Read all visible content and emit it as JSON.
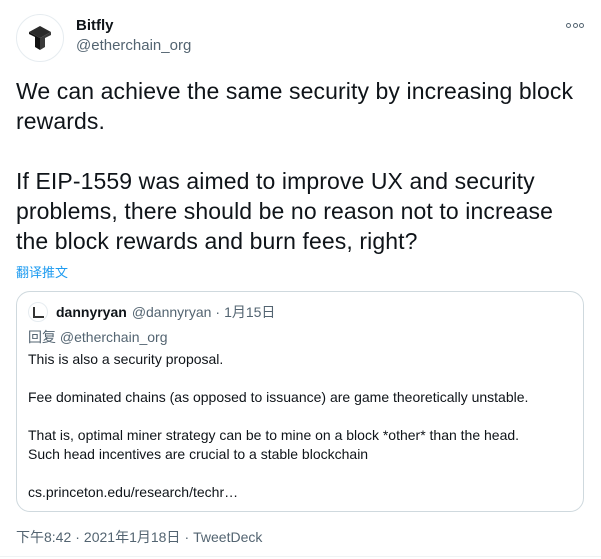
{
  "author": {
    "name": "Bitfly",
    "handle": "@etherchain_org",
    "avatar_icon": "bitfly-logo-icon"
  },
  "more_icon": "more-options-icon",
  "tweet": {
    "paragraphs": [
      "We can achieve the same security by increasing block rewards.",
      "If EIP-1559 was aimed to improve UX and security problems, there should be no reason not to increase the block rewards and burn fees, right?"
    ]
  },
  "translate_label": "翻译推文",
  "quote": {
    "name": "dannyryan",
    "handle": "@dannyryan",
    "separator": "·",
    "date": "1月15日",
    "replying_label": "回复",
    "replying_to": "@etherchain_org",
    "lines": [
      "This is also a security proposal.",
      "Fee dominated chains (as opposed to issuance) are game theoretically unstable.",
      "That is, optimal miner strategy can be to mine on a block *other* than the head.",
      "Such head incentives are crucial to a stable blockchain",
      "cs.princeton.edu/research/techr…"
    ]
  },
  "meta": {
    "time": "下午8:42",
    "separator": "·",
    "date": "2021年1月18日",
    "source": "TweetDeck"
  },
  "colors": {
    "link": "#1d9bf0",
    "secondary_text": "#536471",
    "primary_text": "#0f1419",
    "border": "#cfd9de"
  }
}
